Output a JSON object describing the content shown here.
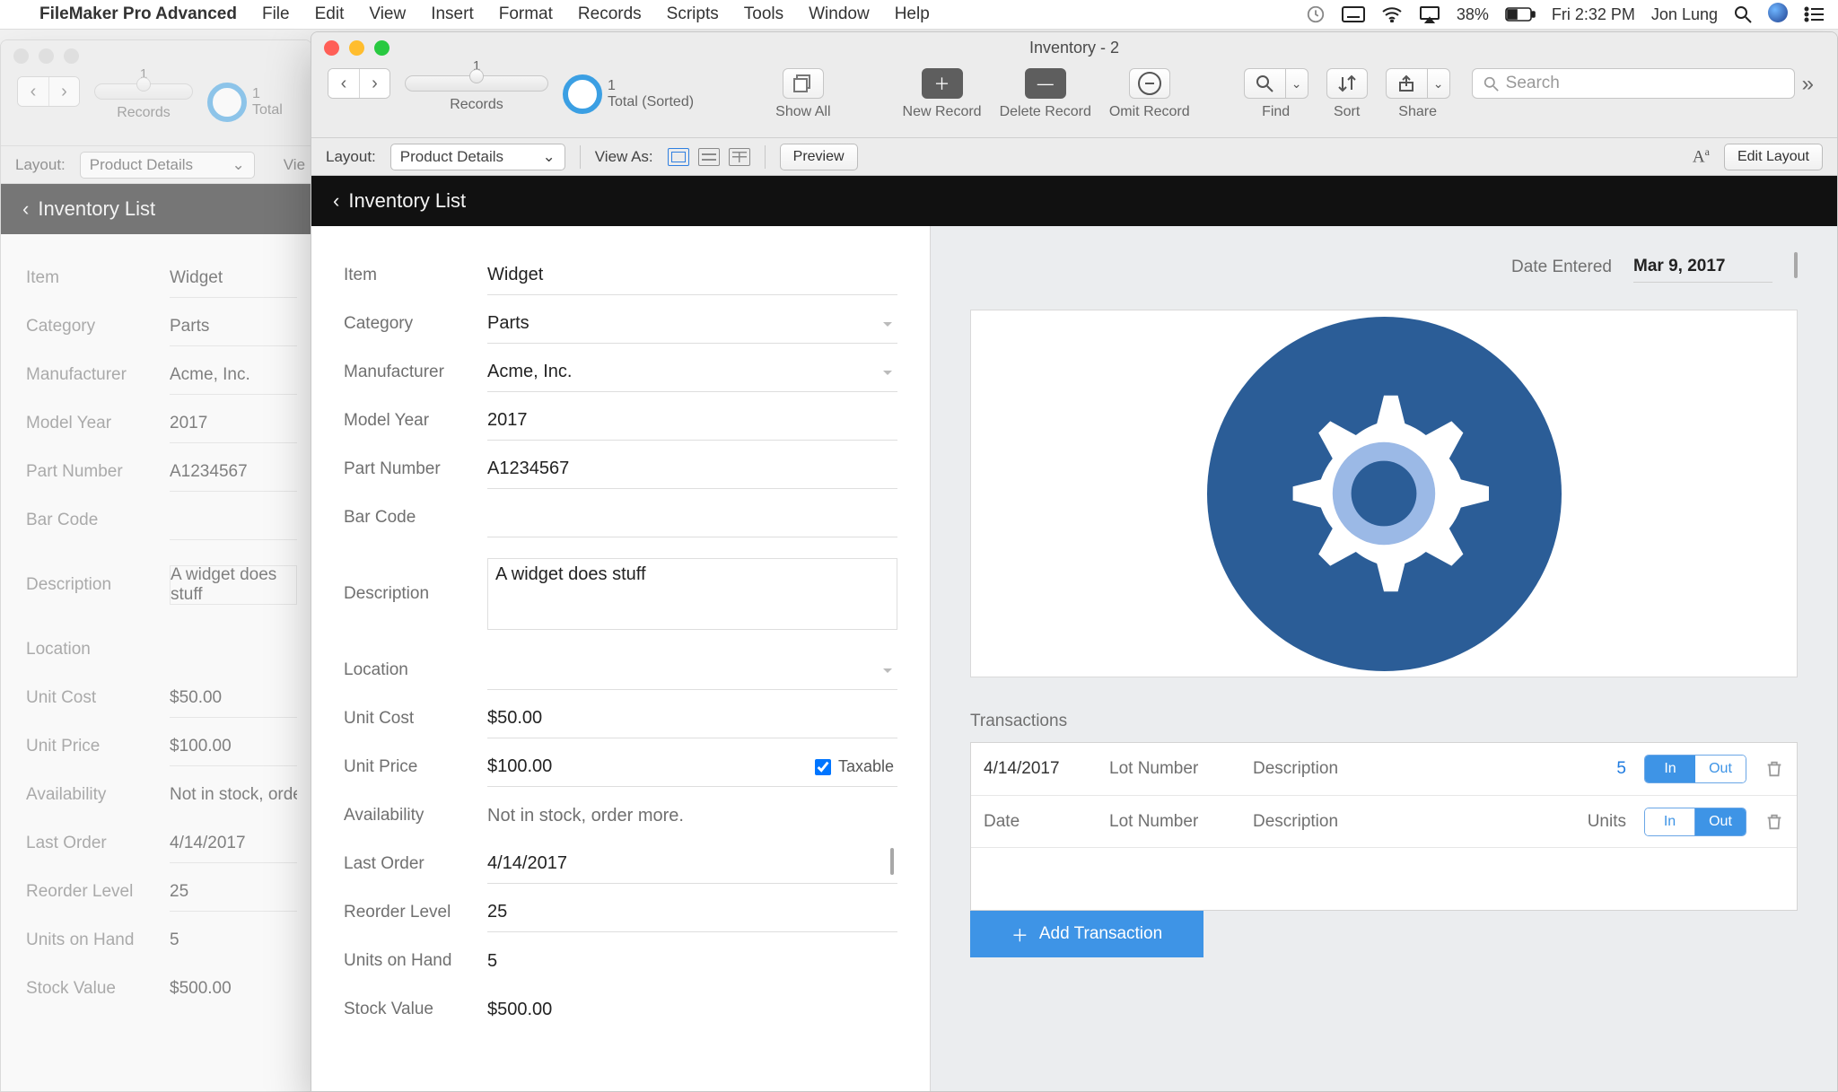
{
  "menubar": {
    "appname": "FileMaker Pro Advanced",
    "menus": [
      "File",
      "Edit",
      "View",
      "Insert",
      "Format",
      "Records",
      "Scripts",
      "Tools",
      "Window",
      "Help"
    ],
    "battery": "38%",
    "clock": "Fri 2:32 PM",
    "user": "Jon Lung"
  },
  "back_window": {
    "toolbar": {
      "record_num": "1",
      "pie_count": "1",
      "pie_label": "Total",
      "records_label": "Records"
    },
    "layoutbar": {
      "layout_label": "Layout:",
      "layout_value": "Product Details",
      "viewas_cut": "Vie"
    },
    "header_title": "Inventory List",
    "fields": {
      "item_l": "Item",
      "item_v": "Widget",
      "category_l": "Category",
      "category_v": "Parts",
      "manufacturer_l": "Manufacturer",
      "manufacturer_v": "Acme, Inc.",
      "modelyear_l": "Model Year",
      "modelyear_v": "2017",
      "partnum_l": "Part Number",
      "partnum_v": "A1234567",
      "barcode_l": "Bar Code",
      "barcode_v": "",
      "description_l": "Description",
      "description_v": "A widget does stuff",
      "location_l": "Location",
      "location_v": "",
      "unitcost_l": "Unit Cost",
      "unitcost_v": "$50.00",
      "unitprice_l": "Unit Price",
      "unitprice_v": "$100.00",
      "availability_l": "Availability",
      "availability_v": "Not in stock, order more.",
      "lastorder_l": "Last Order",
      "lastorder_v": "4/14/2017",
      "reorder_l": "Reorder Level",
      "reorder_v": "25",
      "onhand_l": "Units on Hand",
      "onhand_v": "5",
      "stockvalue_l": "Stock Value",
      "stockvalue_v": "$500.00"
    }
  },
  "front_window": {
    "title": "Inventory - 2",
    "toolbar": {
      "record_num": "1",
      "pie_count": "1",
      "pie_label": "Total (Sorted)",
      "records_label": "Records",
      "showall": "Show All",
      "newrec": "New Record",
      "delrec": "Delete Record",
      "omit": "Omit Record",
      "find": "Find",
      "sort": "Sort",
      "share": "Share",
      "search_placeholder": "Search"
    },
    "layoutbar": {
      "layout_label": "Layout:",
      "layout_value": "Product Details",
      "viewas_label": "View As:",
      "preview": "Preview",
      "editlayout": "Edit Layout"
    },
    "header_title": "Inventory List",
    "left": {
      "item_l": "Item",
      "item_v": "Widget",
      "category_l": "Category",
      "category_v": "Parts",
      "manufacturer_l": "Manufacturer",
      "manufacturer_v": "Acme, Inc.",
      "modelyear_l": "Model Year",
      "modelyear_v": "2017",
      "partnum_l": "Part Number",
      "partnum_v": "A1234567",
      "barcode_l": "Bar Code",
      "barcode_v": "",
      "description_l": "Description",
      "description_v": "A widget does stuff",
      "location_l": "Location",
      "location_v": "",
      "unitcost_l": "Unit Cost",
      "unitcost_v": "$50.00",
      "unitprice_l": "Unit Price",
      "unitprice_v": "$100.00",
      "taxable_l": "Taxable",
      "availability_l": "Availability",
      "availability_v": "Not in stock, order more.",
      "lastorder_l": "Last Order",
      "lastorder_v": "4/14/2017",
      "reorder_l": "Reorder Level",
      "reorder_v": "25",
      "onhand_l": "Units on Hand",
      "onhand_v": "5",
      "stockvalue_l": "Stock Value",
      "stockvalue_v": "$500.00"
    },
    "right": {
      "date_entered_l": "Date Entered",
      "date_entered_v": "Mar 9, 2017",
      "transactions_l": "Transactions",
      "rows": [
        {
          "date": "4/14/2017",
          "lot": "Lot Number",
          "desc": "Description",
          "units": "5",
          "in_on": true
        },
        {
          "date": "Date",
          "lot": "Lot Number",
          "desc": "Description",
          "units": "Units",
          "in_on": false
        }
      ],
      "inout_in": "In",
      "inout_out": "Out",
      "add_trans": "Add Transaction"
    }
  }
}
